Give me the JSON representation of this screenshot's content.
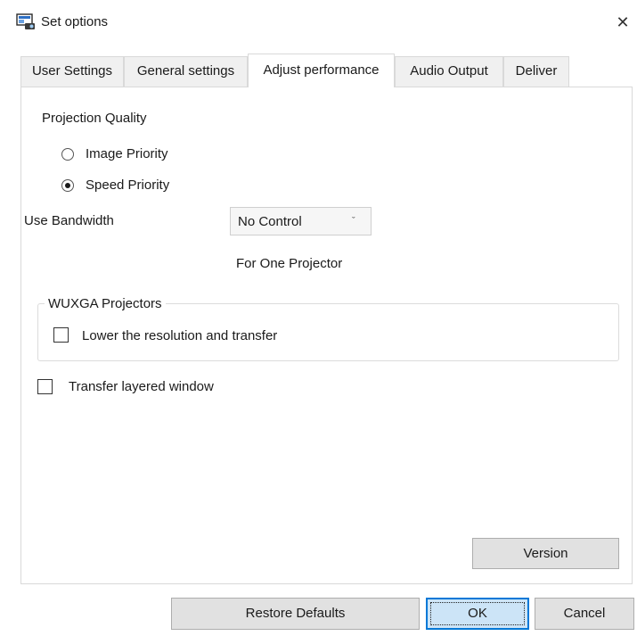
{
  "window": {
    "title": "Set options",
    "close_glyph": "✕",
    "icon": "projector-app-icon"
  },
  "tabs": [
    {
      "label": "User Settings",
      "active": false
    },
    {
      "label": "General settings",
      "active": false
    },
    {
      "label": "Adjust performance",
      "active": true
    },
    {
      "label": "Audio Output",
      "active": false
    },
    {
      "label": "Deliver",
      "active": false
    }
  ],
  "panel": {
    "projection_quality": {
      "label": "Projection Quality",
      "options": [
        {
          "label": "Image Priority",
          "selected": false
        },
        {
          "label": "Speed Priority",
          "selected": true
        }
      ]
    },
    "bandwidth": {
      "label": "Use Bandwidth",
      "selected": "No Control",
      "chevron": "ˇ",
      "note": "For One Projector"
    },
    "wuxga": {
      "legend": "WUXGA Projectors",
      "checkbox_label": "Lower the resolution and transfer",
      "checked": false
    },
    "layered_window": {
      "label": "Transfer layered window",
      "checked": false
    },
    "version_button": "Version"
  },
  "footer": {
    "restore_defaults": "Restore Defaults",
    "ok": "OK",
    "cancel": "Cancel"
  },
  "colors": {
    "accent": "#0078d7",
    "button_bg": "#e1e1e1",
    "ok_bg": "#cce4f7"
  }
}
